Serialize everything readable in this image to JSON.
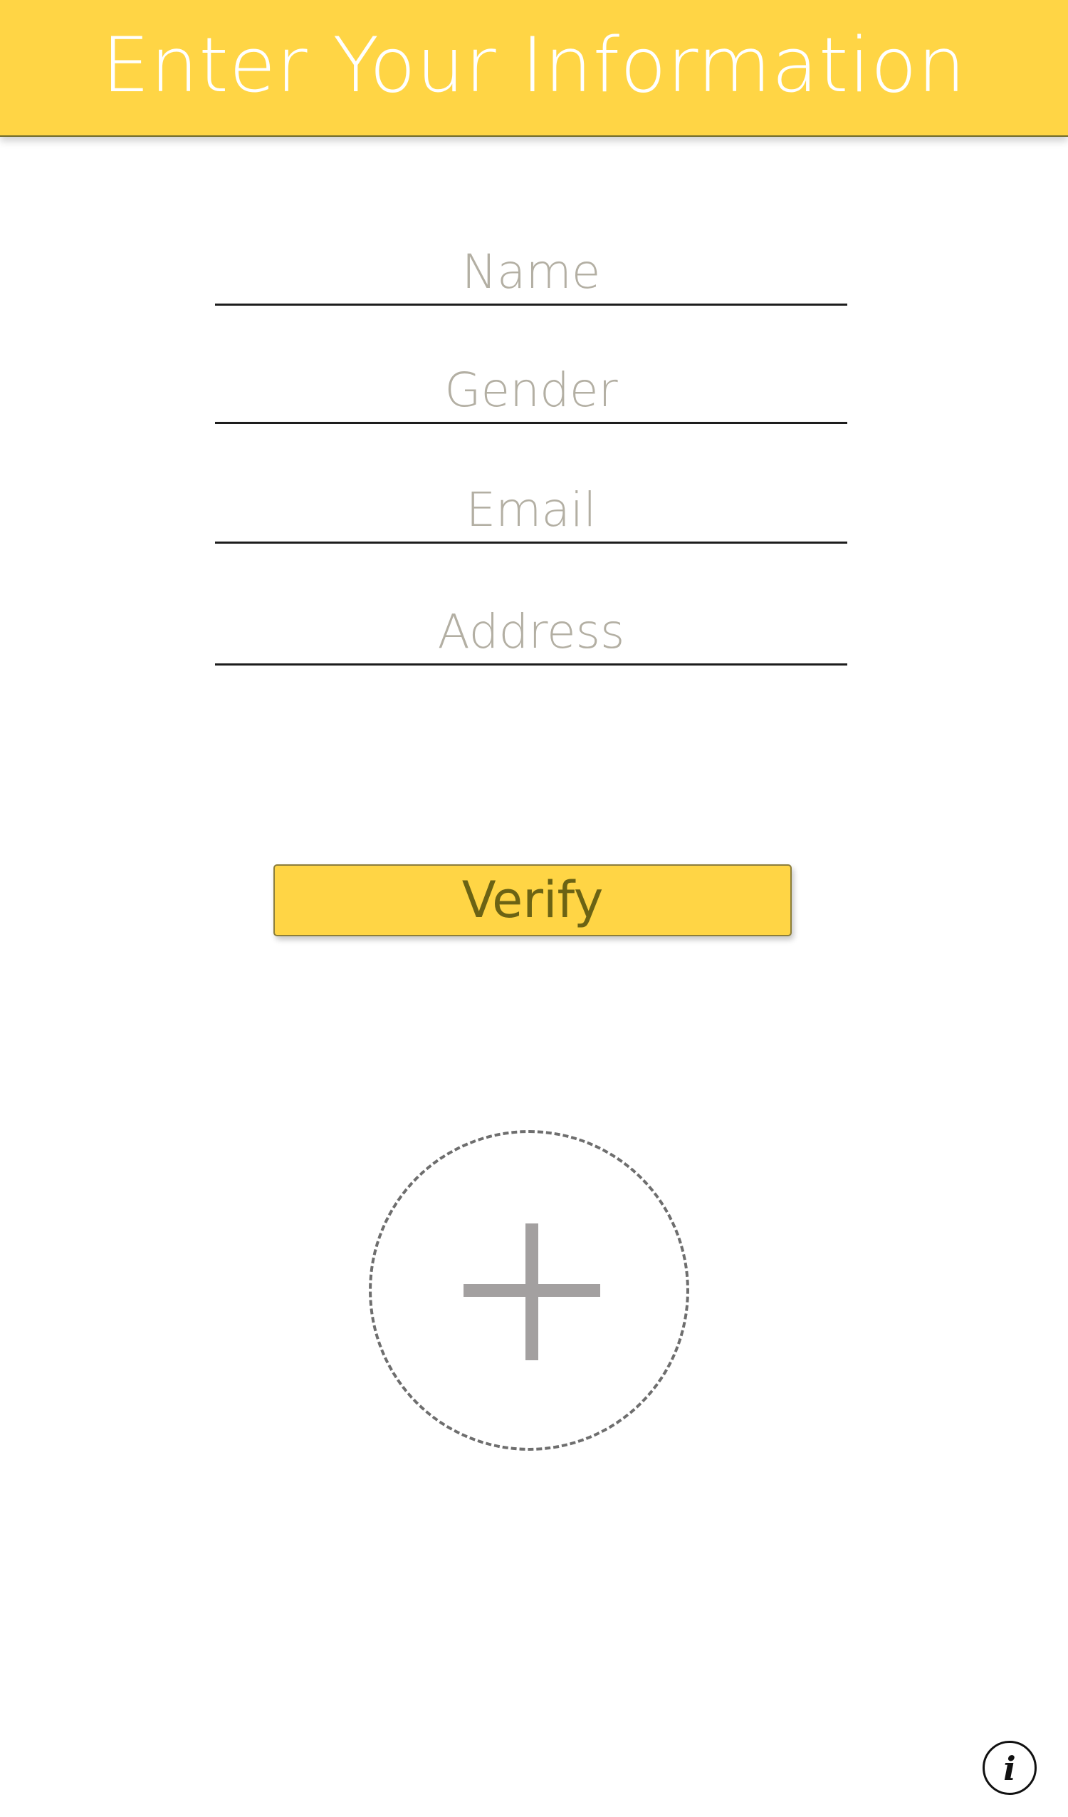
{
  "header": {
    "title": "Enter Your Information"
  },
  "form": {
    "fields": [
      {
        "placeholder": "Name",
        "value": ""
      },
      {
        "placeholder": "Gender",
        "value": ""
      },
      {
        "placeholder": "Email",
        "value": ""
      },
      {
        "placeholder": "Address",
        "value": ""
      }
    ],
    "verify_label": "Verify"
  },
  "add_photo": {
    "icon": "plus-icon"
  },
  "info": {
    "icon": "info-icon",
    "glyph": "i"
  },
  "colors": {
    "accent": "#FFD545",
    "verify_text": "#6b6314",
    "placeholder": "#b3afa3"
  }
}
